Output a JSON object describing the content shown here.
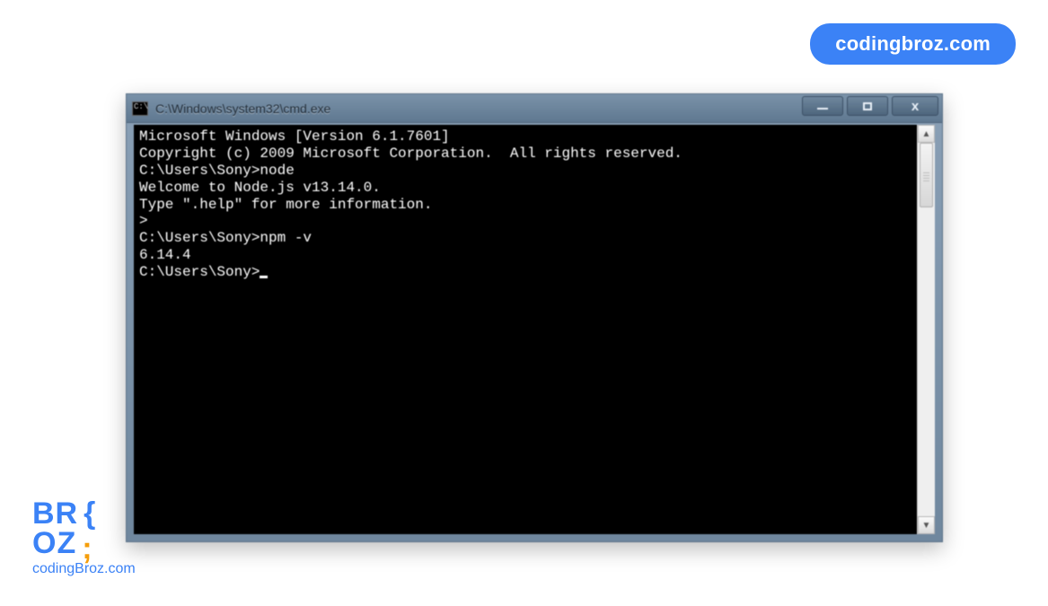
{
  "watermark": {
    "pill": "codingbroz.com",
    "logo_line1_a": "BR",
    "logo_line1_b": "{",
    "logo_line2_a": "OZ",
    "logo_line2_b": ";",
    "sub": "codingBroz.com"
  },
  "window": {
    "title": "C:\\Windows\\system32\\cmd.exe"
  },
  "console": {
    "lines": [
      "Microsoft Windows [Version 6.1.7601]",
      "Copyright (c) 2009 Microsoft Corporation.  All rights reserved.",
      "",
      "C:\\Users\\Sony>node",
      "Welcome to Node.js v13.14.0.",
      "Type \".help\" for more information.",
      ">",
      "",
      "C:\\Users\\Sony>npm -v",
      "6.14.4",
      "",
      "C:\\Users\\Sony>"
    ],
    "prompt_cursor_on_line_index": 11
  }
}
